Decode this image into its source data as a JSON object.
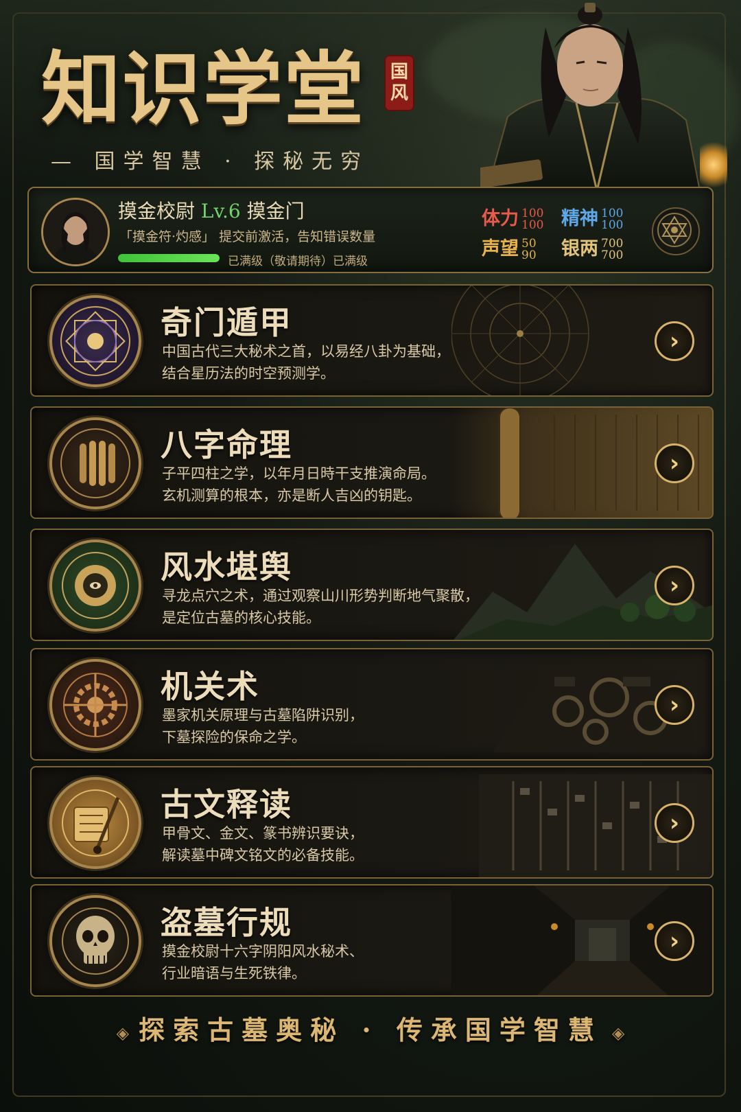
{
  "header": {
    "title": "知识学堂",
    "seal": [
      "国",
      "风"
    ],
    "subtitle": "— 国学智慧 · 探秘无穷"
  },
  "player": {
    "name": "摸金校尉",
    "level": "Lv.6",
    "faction": "摸金门",
    "note": "「摸金符·灼感」 提交前激活，告知错误数量",
    "xp_progress": 1.0,
    "xp_text": "已满级（敬请期待）已满级",
    "stats": {
      "stamina": {
        "label": "体力",
        "cur": "100",
        "max": "100",
        "color": "#e85a4a"
      },
      "spirit": {
        "label": "精神",
        "cur": "100",
        "max": "100",
        "color": "#5ea8e8"
      },
      "fame": {
        "label": "声望",
        "cur": "50",
        "max": "90",
        "color": "#e7b24a"
      },
      "silver": {
        "label": "银两",
        "cur": "700",
        "max": "700",
        "color": "#e3c37a"
      }
    }
  },
  "cards": [
    {
      "title": "奇门遁甲",
      "desc": "中国古代三大秘术之首，以易经八卦为基础，\n结合星历法的时空预测学。",
      "icon": "bagua-compass-icon"
    },
    {
      "title": "八字命理",
      "desc": "子平四柱之学，以年月日時干支推演命局。\n玄机测算的根本，亦是断人吉凶的钥匙。",
      "icon": "bamboo-scroll-icon"
    },
    {
      "title": "风水堪舆",
      "desc": "寻龙点穴之术，通过观察山川形势判断地气聚散，\n是定位古墓的核心技能。",
      "icon": "luopan-icon"
    },
    {
      "title": "机关术",
      "desc": "墨家机关原理与古墓陷阱识别，\n下墓探险的保命之学。",
      "icon": "gear-mechanism-icon"
    },
    {
      "title": "古文释读",
      "desc": "甲骨文、金文、篆书辨识要诀，\n解读墓中碑文铭文的必备技能。",
      "icon": "scroll-brush-icon"
    },
    {
      "title": "盗墓行规",
      "desc": "摸金校尉十六字阴阳风水秘术、\n行业暗语与生死铁律。",
      "icon": "skull-icon"
    }
  ],
  "footer": {
    "text": "探索古墓奥秘 · 传承国学智慧",
    "ornament": "◈"
  }
}
